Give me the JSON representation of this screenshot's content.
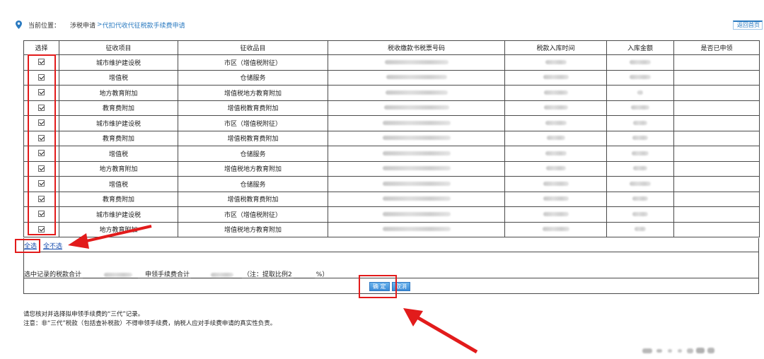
{
  "breadcrumb": {
    "label": "当前位置：",
    "root": "涉税申请",
    "arrow": ">",
    "current": "代扣代收代征税款手续费申请"
  },
  "home_button": "返回首页",
  "table": {
    "headers": [
      "选择",
      "征收项目",
      "征收品目",
      "税收缴款书税票号码",
      "税款入库时间",
      "入库金额",
      "是否已申领"
    ],
    "rows": [
      {
        "item": "城市维护建设税",
        "subitem": "市区（增值税附征）"
      },
      {
        "item": "增值税",
        "subitem": "仓储服务"
      },
      {
        "item": "地方教育附加",
        "subitem": "增值税地方教育附加"
      },
      {
        "item": "教育费附加",
        "subitem": "增值税教育费附加"
      },
      {
        "item": "城市维护建设税",
        "subitem": "市区（增值税附征）"
      },
      {
        "item": "教育费附加",
        "subitem": "增值税教育费附加"
      },
      {
        "item": "增值税",
        "subitem": "仓储服务"
      },
      {
        "item": "地方教育附加",
        "subitem": "增值税地方教育附加"
      },
      {
        "item": "增值税",
        "subitem": "仓储服务"
      },
      {
        "item": "教育费附加",
        "subitem": "增值税教育费附加"
      },
      {
        "item": "城市维护建设税",
        "subitem": "市区（增值税附征）"
      },
      {
        "item": "地方教育附加",
        "subitem": "增值税地方教育附加"
      }
    ]
  },
  "select_all": "全选",
  "select_none": "全不选",
  "summary": {
    "tax_total_label": "选中记录的税款合计",
    "fee_total_label": "申领手续费合计",
    "ratio_note_prefix": "（注：提取比例2",
    "ratio_note_suffix": "%）"
  },
  "buttons": {
    "confirm": "确 定",
    "cancel": "取消"
  },
  "notes": {
    "line1": "请您核对并选择拟申领手续费的“三代”记录。",
    "line2": "注意：非“三代”税款（包括查补税款）不得申领手续费，纳税人应对手续费申请的真实性负责。"
  },
  "colors": {
    "link": "#2a7ac0",
    "annotation": "#e21b1b",
    "button": "#3a8ad6"
  }
}
